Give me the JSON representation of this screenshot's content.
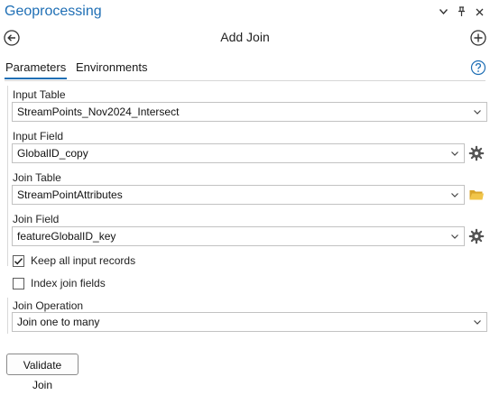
{
  "pane": {
    "title": "Geoprocessing",
    "controls": [
      "chevron-down-icon",
      "pin-icon",
      "close-icon"
    ]
  },
  "tool": {
    "title": "Add Join"
  },
  "tabs": [
    {
      "label": "Parameters",
      "active": true
    },
    {
      "label": "Environments",
      "active": false
    }
  ],
  "params": {
    "input_table": {
      "label": "Input Table",
      "value": "StreamPoints_Nov2024_Intersect"
    },
    "input_field": {
      "label": "Input Field",
      "value": "GlobalID_copy"
    },
    "join_table": {
      "label": "Join Table",
      "value": "StreamPointAttributes"
    },
    "join_field": {
      "label": "Join Field",
      "value": "featureGlobalID_key"
    },
    "keep_all": {
      "label": "Keep all input records",
      "checked": true
    },
    "index_join": {
      "label": "Index join fields",
      "checked": false
    },
    "join_operation": {
      "label": "Join Operation",
      "value": "Join one to many"
    }
  },
  "buttons": {
    "validate": "Validate Join"
  },
  "colors": {
    "accent": "#1f6fb5",
    "folder": "#e8b93b"
  }
}
